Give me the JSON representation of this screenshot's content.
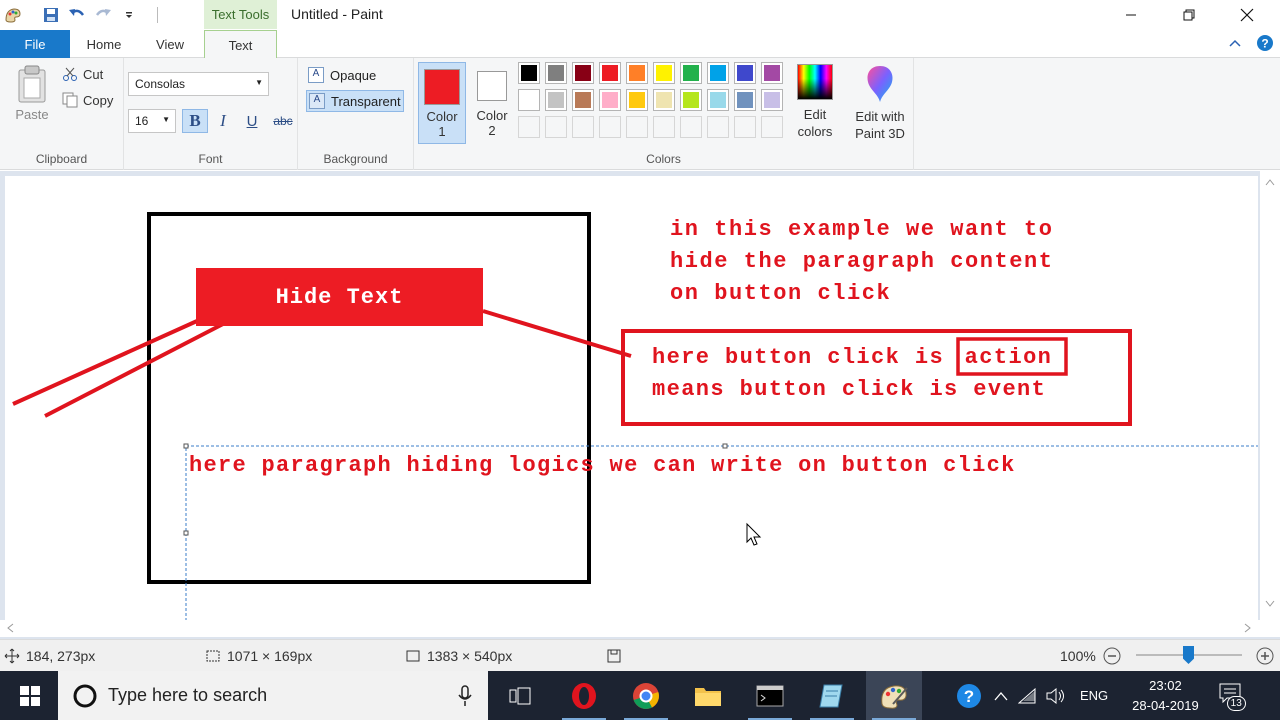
{
  "title_bar": {
    "title": "Untitled - Paint",
    "context_tab_label": "Text Tools",
    "quick_access": [
      "paint-menu-icon",
      "save-icon",
      "undo-icon",
      "redo-icon",
      "customize-icon"
    ]
  },
  "tabs": {
    "file": "File",
    "home": "Home",
    "view": "View",
    "text": "Text"
  },
  "ribbon": {
    "clipboard": {
      "paste": "Paste",
      "cut": "Cut",
      "copy": "Copy",
      "label": "Clipboard"
    },
    "font": {
      "family": "Consolas",
      "size": "16",
      "bold": "B",
      "italic": "I",
      "underline": "U",
      "strike": "abc",
      "label": "Font"
    },
    "background": {
      "opaque": "Opaque",
      "transparent": "Transparent",
      "label": "Background",
      "opaque_glyph": "A",
      "transparent_glyph": "A"
    },
    "colors": {
      "color1": "Color",
      "color1_num": "1",
      "color2": "Color",
      "color2_num": "2",
      "color1_value": "#ed1c24",
      "color2_value": "#ffffff",
      "label": "Colors",
      "edit_colors": "Edit colors",
      "palette": [
        "#000000",
        "#7f7f7f",
        "#880015",
        "#ed1c24",
        "#ff7f27",
        "#fff200",
        "#22b14c",
        "#00a2e8",
        "#3f48cc",
        "#a349a4",
        "#ffffff",
        "#c3c3c3",
        "#b97a57",
        "#ffaec9",
        "#ffc90e",
        "#efe4b0",
        "#b5e61d",
        "#99d9ea",
        "#7092be",
        "#c8bfe7"
      ]
    },
    "paint3d": {
      "label": "Edit with Paint 3D"
    }
  },
  "canvas": {
    "button_text": "Hide Text",
    "note_lines": [
      "in this example we want to",
      "hide the paragraph content",
      "on button click"
    ],
    "box_line1_prefix": "here button click is",
    "box_line1_word": "action",
    "box_line2": "means button click is event",
    "paragraph": "here paragraph hiding logics we can write on button click",
    "ink_color": "#e0141e"
  },
  "status": {
    "cursor_pos": "184, 273px",
    "selection_size": "1071 × 169px",
    "image_size": "1383 × 540px",
    "zoom": "100%"
  },
  "taskbar": {
    "search_placeholder": "Type here to search",
    "language": "ENG",
    "time": "23:02",
    "date": "28-04-2019",
    "notification_count": "13"
  }
}
